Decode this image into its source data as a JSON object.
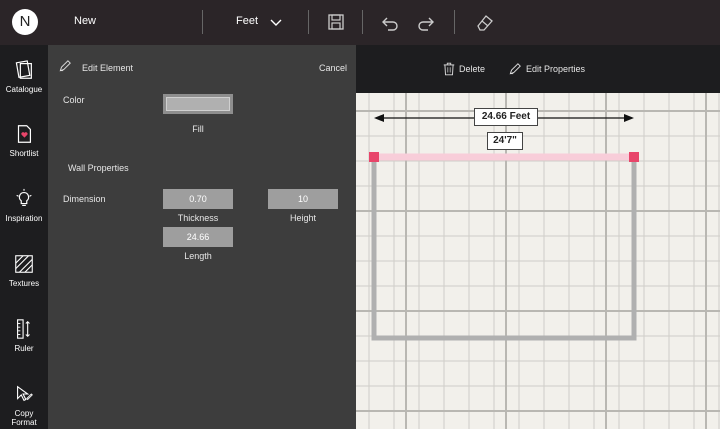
{
  "topbar": {
    "logo_letter": "N",
    "new_label": "New",
    "unit_value": "Feet"
  },
  "sidebar": {
    "items": [
      {
        "label": "Catalogue",
        "icon": "catalogue-icon"
      },
      {
        "label": "Shortlist",
        "icon": "shortlist-icon"
      },
      {
        "label": "Inspiration",
        "icon": "lightbulb-icon"
      },
      {
        "label": "Textures",
        "icon": "textures-icon"
      },
      {
        "label": "Ruler",
        "icon": "ruler-icon"
      },
      {
        "label": "Copy",
        "label2": "Format",
        "icon": "copy-format-icon"
      }
    ]
  },
  "panel": {
    "title": "Edit Element",
    "cancel_label": "Cancel",
    "color_label": "Color",
    "fill_label": "Fill",
    "wall_properties_label": "Wall Properties",
    "dimension_label": "Dimension",
    "thickness_value": "0.70",
    "thickness_label": "Thickness",
    "height_value": "10",
    "height_label": "Height",
    "length_value": "24.66",
    "length_label": "Length"
  },
  "canvas_toolbar": {
    "delete_label": "Delete",
    "edit_properties_label": "Edit Properties"
  },
  "canvas": {
    "measure_feet": "24.66 Feet",
    "measure_ftin": "24'7\"",
    "wall_selected_color": "#f8cdd9",
    "handle_color": "#e8456a",
    "wall_color": "#b0b0b0"
  }
}
